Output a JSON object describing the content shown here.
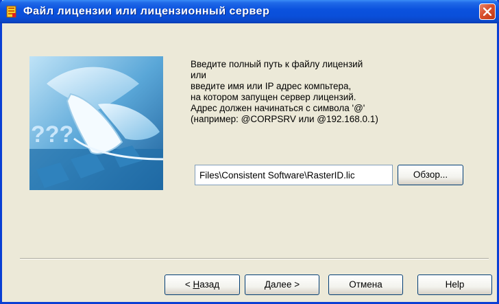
{
  "window": {
    "title": "Файл лицензии или лицензионный сервер"
  },
  "instructions": {
    "lines": [
      "Введите полный путь к файлу лицензий",
      "или",
      "введите имя или IP адрес компьтера,",
      "на котором запущен сервер лицензий.",
      "Адрес должен начинаться с символа '@'",
      "(например: @CORPSRV или @192.168.0.1)"
    ]
  },
  "illustration": {
    "question_marks": "???"
  },
  "license_path": {
    "value": "Files\\Consistent Software\\RasterID.lic"
  },
  "buttons": {
    "browse": "Обзор...",
    "back_mnemonic": "Н",
    "back_prefix": "< ",
    "back_rest": "азад",
    "next_mnemonic": "Д",
    "next_rest": "алее >",
    "cancel": "Отмена",
    "help": "Help"
  },
  "colors": {
    "titlebar": "#0a4fd9",
    "window_bg": "#ece9d8",
    "close_button": "#d8502e"
  }
}
